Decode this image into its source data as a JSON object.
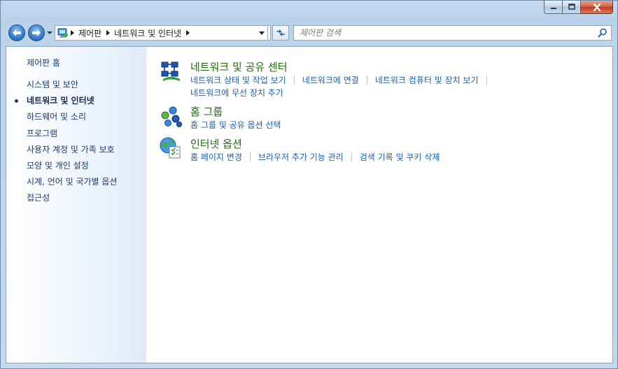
{
  "window": {
    "controls": {
      "minimize": "minimize",
      "maximize": "maximize",
      "close": "close"
    }
  },
  "address": {
    "breadcrumbs": [
      "제어판",
      "네트워크 및 인터넷"
    ]
  },
  "search": {
    "placeholder": "제어판 검색"
  },
  "sidebar": {
    "home": "제어판 홈",
    "items": [
      {
        "label": "시스템 및 보안",
        "current": false
      },
      {
        "label": "네트워크 및 인터넷",
        "current": true
      },
      {
        "label": "하드웨어 및 소리",
        "current": false
      },
      {
        "label": "프로그램",
        "current": false
      },
      {
        "label": "사용자 계정 및 가족 보호",
        "current": false
      },
      {
        "label": "모양 및 개인 설정",
        "current": false
      },
      {
        "label": "시계, 언어 및 국가별 옵션",
        "current": false
      },
      {
        "label": "접근성",
        "current": false
      }
    ]
  },
  "categories": [
    {
      "title": "네트워크 및 공유 센터",
      "icon": "network-center-icon",
      "links": [
        "네트워크 상태 및 작업 보기",
        "네트워크에 연결",
        "네트워크 컴퓨터 및 장치 보기",
        "네트워크에 무선 장치 추가"
      ]
    },
    {
      "title": "홈 그룹",
      "icon": "homegroup-icon",
      "links": [
        "홈 그룹 및 공유 옵션 선택"
      ]
    },
    {
      "title": "인터넷 옵션",
      "icon": "internet-options-icon",
      "links": [
        "홈 페이지 변경",
        "브라우저 추가 기능 관리",
        "검색 기록 및 쿠키 삭제"
      ]
    }
  ],
  "colors": {
    "category_title": "#1e6e0c",
    "link": "#1a5fb4",
    "sidebar_text": "#1a3b6b"
  }
}
